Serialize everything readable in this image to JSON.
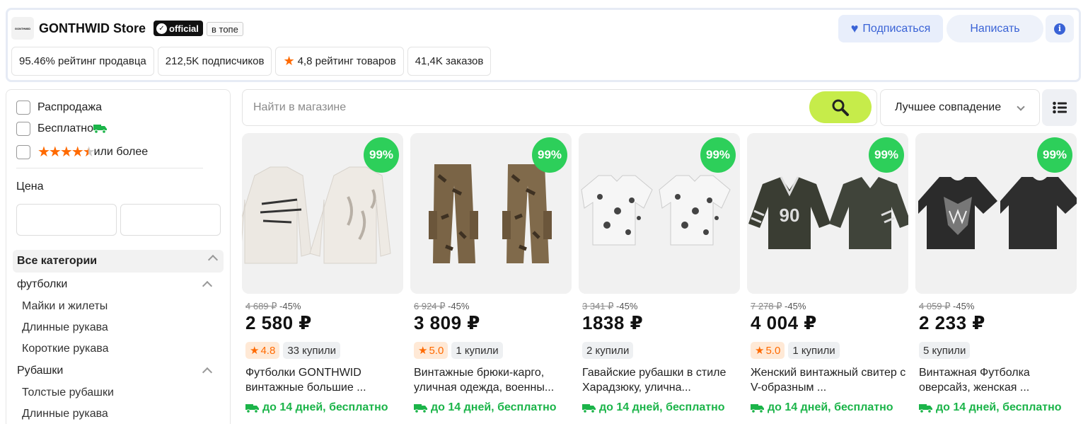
{
  "store": {
    "logo_text": "GONTHWID",
    "name": "GONTHWID Store",
    "official_label": "official",
    "top_tag": "в топе",
    "subscribe_label": "Подписаться",
    "write_label": "Написать",
    "info_label": "i",
    "stats": [
      {
        "text": "95.46% рейтинг продавца"
      },
      {
        "text": "212,5K подписчиков"
      },
      {
        "text": "4,8 рейтинг товаров",
        "icon": "star-icon"
      },
      {
        "text": "41,4K заказов"
      }
    ]
  },
  "sidebar": {
    "filters": {
      "sale": "Распродажа",
      "free": "Бесплатно",
      "rating": "или более",
      "rating_value": 4.5
    },
    "price_title": "Цена",
    "price_from": "",
    "price_to": "",
    "all_categories": "Все категории",
    "categories": [
      {
        "label": "футболки",
        "children": [
          "Майки и жилеты",
          "Длинные рукава",
          "Короткие рукава"
        ]
      },
      {
        "label": "Рубашки",
        "children": [
          "Толстые рубашки",
          "Длинные рукава"
        ]
      }
    ]
  },
  "search": {
    "placeholder": "Найти в магазине",
    "value": ""
  },
  "sort": {
    "selected": "Лучшее совпадение"
  },
  "products": [
    {
      "badge": "99%",
      "old_price": "4 689 ₽",
      "discount": "-45%",
      "price": "2 580 ₽",
      "rating": "4.8",
      "bought": "33 купили",
      "title": "Футболки GONTHWID винтажные большие ...",
      "delivery": "до 14 дней, бесплатно",
      "image": "longsleeve-white"
    },
    {
      "badge": "99%",
      "old_price": "6 924 ₽",
      "discount": "-45%",
      "price": "3 809 ₽",
      "rating": "5.0",
      "bought": "1 купили",
      "title": "Винтажные брюки-карго, уличная одежда, военны...",
      "delivery": "до 14 дней, бесплатно",
      "image": "camo-pants"
    },
    {
      "badge": "99%",
      "old_price": "3 341 ₽",
      "discount": "-45%",
      "price": "1838 ₽",
      "rating": "",
      "bought": "2 купили",
      "title": "Гавайские рубашки в стиле Харадзюку, улична...",
      "delivery": "до 14 дней, бесплатно",
      "image": "print-shirt"
    },
    {
      "badge": "99%",
      "old_price": "7 278 ₽",
      "discount": "-45%",
      "price": "4 004 ₽",
      "rating": "5.0",
      "bought": "1 купили",
      "title": "Женский винтажный свитер с V-образным ...",
      "delivery": "до 14 дней, бесплатно",
      "image": "jersey-90"
    },
    {
      "badge": "99%",
      "old_price": "4 059 ₽",
      "discount": "-45%",
      "price": "2 233 ₽",
      "rating": "",
      "bought": "5 купили",
      "title": "Винтажная Футболка оверсайз, женская ...",
      "delivery": "до 14 дней, бесплатно",
      "image": "black-tee"
    }
  ],
  "colors": {
    "accent_blue": "#3a63d6",
    "search_button": "#c6ec4a",
    "badge_green": "#2dcf5a",
    "delivery_green": "#1bb449",
    "rating_orange": "#ff6a00"
  }
}
